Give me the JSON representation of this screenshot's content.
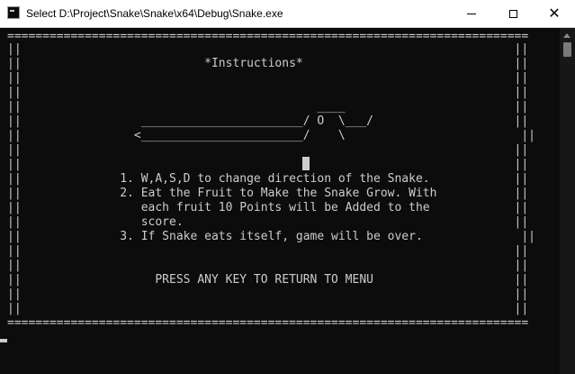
{
  "window": {
    "title": "Select D:\\Project\\Snake\\Snake\\x64\\Debug\\Snake.exe",
    "close_glyph": "✕"
  },
  "icons": {
    "app": "console-app-icon",
    "minimize": "minimize-icon",
    "maximize": "maximize-icon",
    "close": "close-icon",
    "scroll_up": "scroll-up-arrow-icon"
  },
  "colors": {
    "console_background": "#0c0c0c",
    "console_text": "#cccccc",
    "titlebar": "#ffffff"
  },
  "console": {
    "border_top": "==========================================================================",
    "frame_blank": "||                                                                      ||",
    "title_line": "||                          *Instructions*                              ||",
    "snake_line1": "||                                          ____                        ||",
    "snake_line2": "||                 _______________________/ O  \\___/                    ||",
    "snake_line3": "||                <_______________________/    \\                         ||",
    "rule1": "||              1. W,A,S,D to change direction of the Snake.            ||",
    "rule2a": "||              2. Eat the Fruit to Make the Snake Grow. With           ||",
    "rule2b": "||                 each fruit 10 Points will be Added to the            ||",
    "rule2c": "||                 score.                                               ||",
    "rule3": "||              3. If Snake eats itself, game will be over.              ||",
    "menu_prompt": "||                   PRESS ANY KEY TO RETURN TO MENU                    ||",
    "border_bottom": "=========================================================================="
  }
}
